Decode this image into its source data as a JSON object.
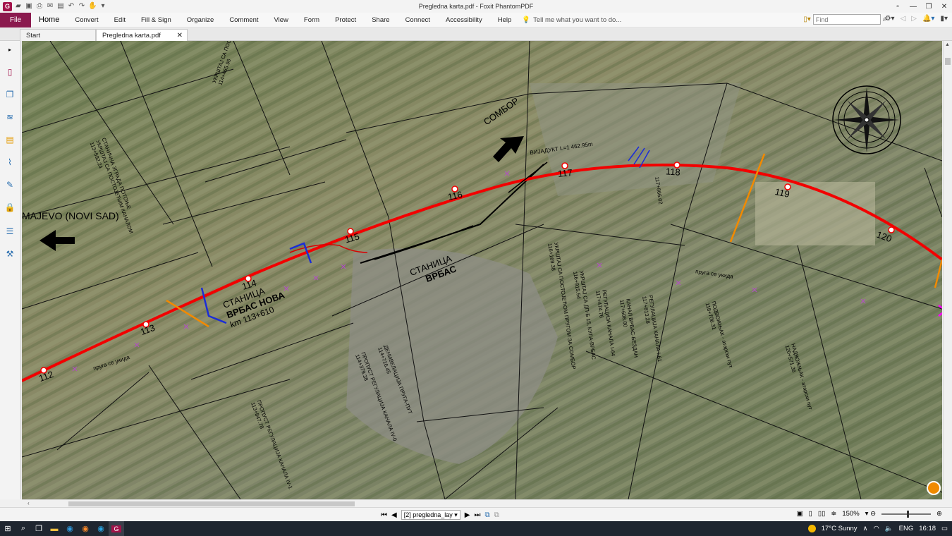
{
  "window": {
    "title": "Pregledna karta.pdf - Foxit PhantomPDF"
  },
  "menu": {
    "file": "File",
    "tabs": [
      "Home",
      "Convert",
      "Edit",
      "Fill & Sign",
      "Organize",
      "Comment",
      "View",
      "Form",
      "Protect",
      "Share",
      "Connect",
      "Accessibility",
      "Help"
    ],
    "tell_me": "Tell me what you want to do...",
    "find_placeholder": "Find"
  },
  "doc_tabs": {
    "start": "Start",
    "active": "Pregledna karta.pdf"
  },
  "map": {
    "direction_left": "MAJEVO (NOVI SAD)",
    "direction_up": "СОМБОР",
    "viaduct": "ВИЈАДУКТ L=1 462.95m",
    "station1_title": "СТАНИЦА",
    "station1_name": "ВРБАС НОВА",
    "station1_km": "km 113+610",
    "station2_title": "СТАНИЦА",
    "station2_name": "ВРБАС",
    "track_removed_1": "пруга се укида",
    "track_removed_2": "пруга се укида",
    "chainage": [
      "112",
      "113",
      "114",
      "115",
      "116",
      "117",
      "118",
      "119",
      "120"
    ],
    "label_a_1": "УКРШТАЈ СА ПОСТОЈЕЋИМ КАНАЛОМ",
    "label_a_2": "114+465.96",
    "label_b_1": "СТАНИЧНА ЗГРАДА ПОТОЊЕ",
    "label_b_2": "УКРШТАЈ СА ПОСТОЈЕЋИМ КАНАЛОМ",
    "label_b_3": "113+592.24",
    "label_c_1": "ПРОПУСТ РЕГУЛАЦИЈА КАНАЛА IV-1",
    "label_c_2": "113+847.78",
    "label_d_1": "ПРОПУСТ РЕГУЛАЦИЈА КАНАЛА IV-0",
    "label_d_2": "114+379.38",
    "label_e_1": "ДЕНИВЕЛАЦИЈА ПРУГА-ПУТ",
    "label_e_2": "114+716.45",
    "label_f_1": "УКРШТАЈ СА ПОСТОЈЕЋОМ ПРУГОМ ЗА СОМБОР",
    "label_f_2": "116+169.38",
    "label_g_1": "УКРШТАЈ СА ДП-Б 15, КУЛА-ВРБАС",
    "label_g_2": "116+915.54",
    "label_h_1": "РЕГУЛАЦИЈА КАНАЛА I-64",
    "label_h_2": "117+474.76",
    "label_i_1": "КАНАЛ ВРБАС-БЕЗДАН",
    "label_i_2": "117+608.00",
    "label_j_1": "РЕГУЛАЦИЈА КАНАЛА I-61",
    "label_j_2": "117+813.28",
    "label_k": "117+866.02",
    "label_l_1": "ПОДВОЖЊАК - атарски пут",
    "label_l_2": "118+708.31",
    "label_m_1": "НАДВОЖЊАК - атарски пут",
    "label_m_2": "120+571.36"
  },
  "status": {
    "page_field": "[2] pregledna_lay",
    "zoom": "150%"
  },
  "taskbar": {
    "weather": "17°C Sunny",
    "lang": "ENG",
    "time": "16:18"
  }
}
